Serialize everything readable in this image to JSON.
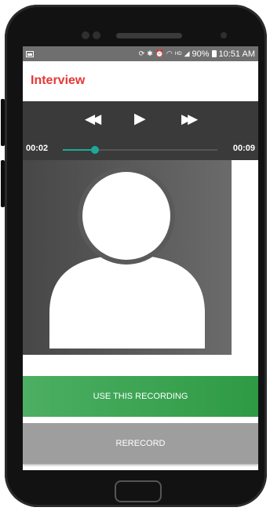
{
  "status_bar": {
    "battery_percent": "90%",
    "time": "10:51 AM",
    "icons": [
      "image-icon",
      "sync-icon",
      "bluetooth-icon",
      "alarm-icon",
      "wifi-icon",
      "hd-icon",
      "signal-icon",
      "battery-icon"
    ]
  },
  "header": {
    "title": "Interview"
  },
  "player": {
    "current_time": "00:02",
    "total_time": "00:09",
    "progress": 0.21,
    "controls": {
      "rewind": "◀◀",
      "play": "▶",
      "fast_forward": "▶▶"
    }
  },
  "actions": {
    "use_label": "USE THIS RECORDING",
    "rerecord_label": "RERECORD"
  },
  "colors": {
    "title": "#e53935",
    "accent": "#1da99a",
    "use_button": "#3fa554",
    "rerecord_button": "#9e9e9e"
  }
}
